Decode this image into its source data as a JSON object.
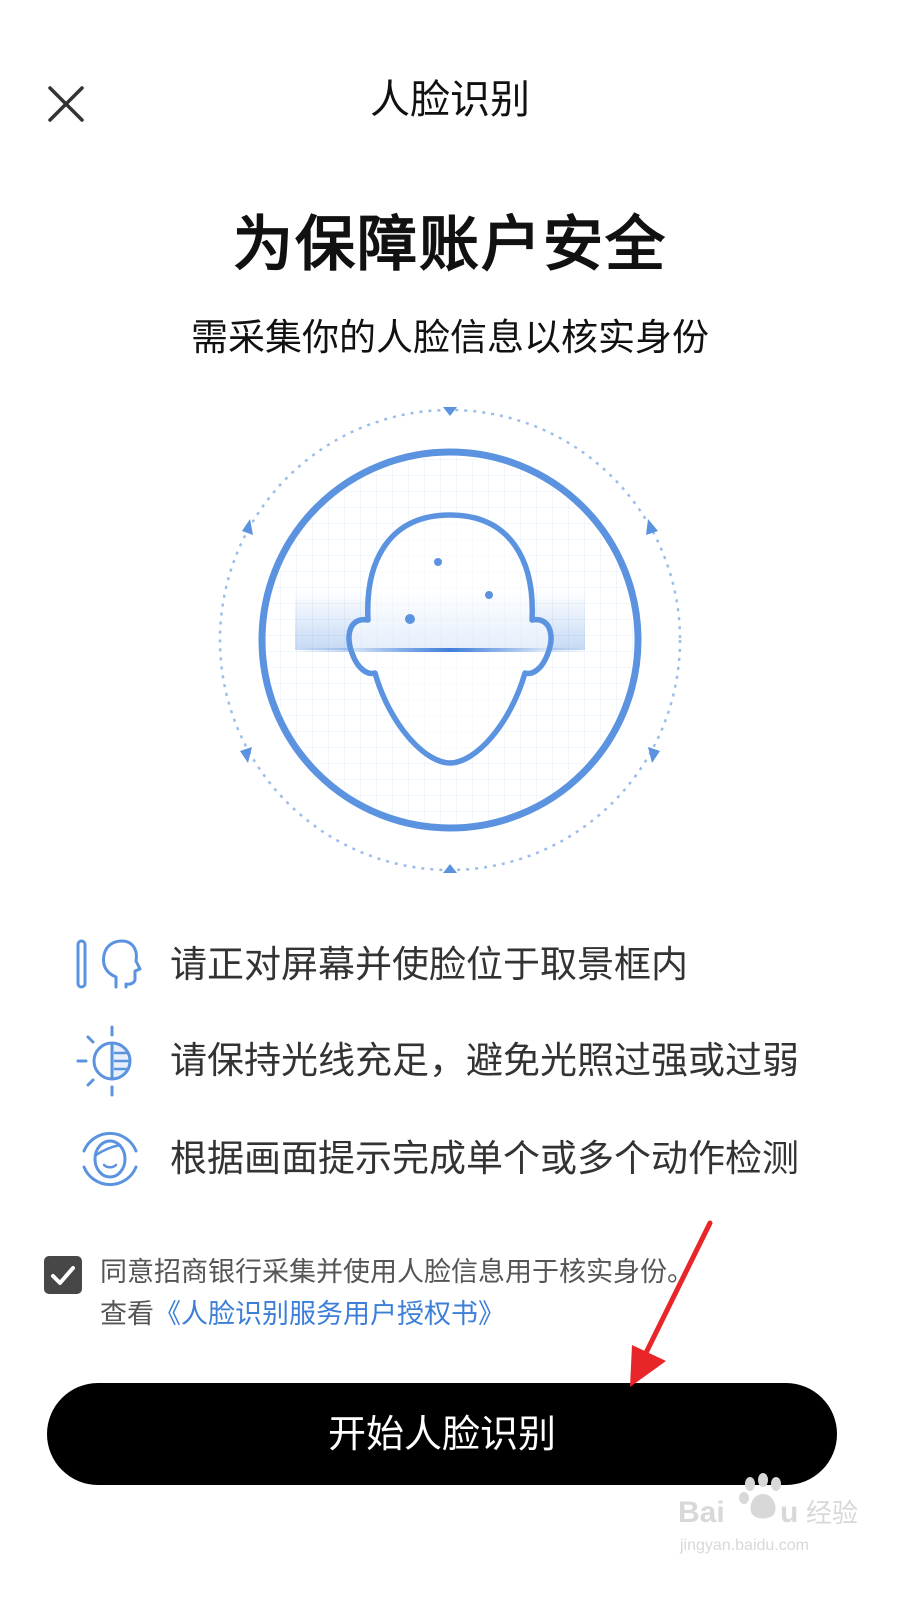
{
  "header": {
    "title": "人脸识别",
    "close_icon": "close-icon"
  },
  "intro": {
    "headline": "为保障账户安全",
    "subhead": "需采集你的人脸信息以核实身份"
  },
  "illustration": {
    "icon": "face-scan-icon",
    "color": "#5b93e0"
  },
  "tips": [
    {
      "icon": "face-frame-icon",
      "text": "请正对屏幕并使脸位于取景框内"
    },
    {
      "icon": "light-icon",
      "text": "请保持光线充足，避免光照过强或过弱"
    },
    {
      "icon": "face-action-icon",
      "text": "根据画面提示完成单个或多个动作检测"
    }
  ],
  "consent": {
    "checked": true,
    "line1": "同意招商银行采集并使用人脸信息用于核实身份。",
    "view_prefix": "查看",
    "link_text": "《人脸识别服务用户授权书》"
  },
  "actions": {
    "start_label": "开始人脸识别"
  },
  "colors": {
    "accent": "#5b93e0",
    "link": "#3d7fd8",
    "button_bg": "#000000",
    "annotation_arrow": "#e8262a"
  }
}
